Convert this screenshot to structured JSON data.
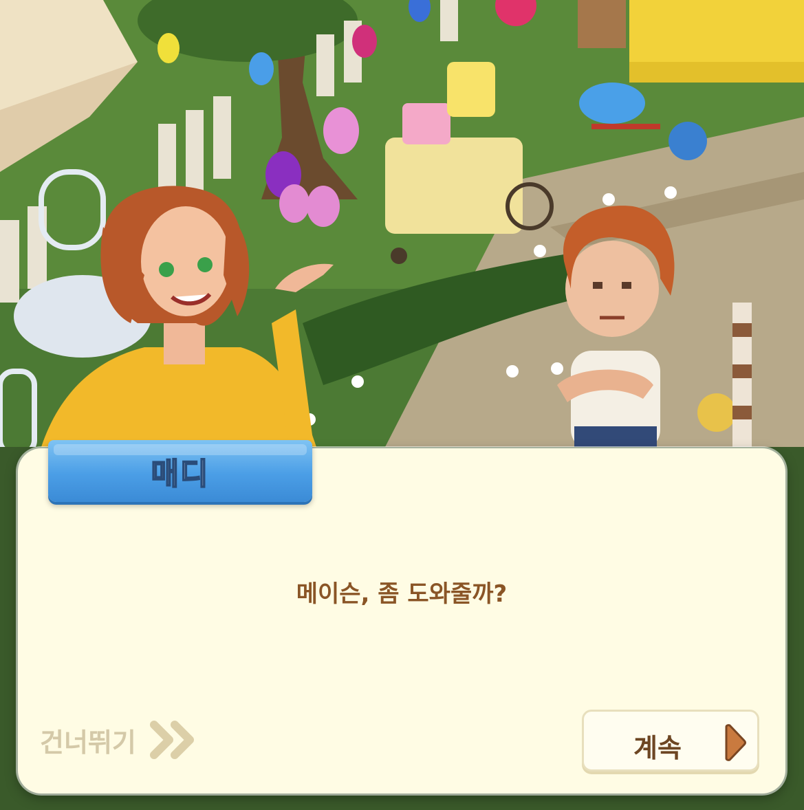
{
  "dialog": {
    "speaker_name": "매디",
    "message": "메이슨, 좀 도와줄까?"
  },
  "controls": {
    "skip_label": "건너뛰기",
    "continue_label": "계속"
  },
  "colors": {
    "panel_bg": "#fffce4",
    "name_tag": "#4b9ee6",
    "message_text": "#8a5526",
    "skip_text": "#d4c9a8",
    "continue_arrow": "#c97a3f"
  },
  "icons": {
    "skip": "double-chevron-right-icon",
    "continue": "play-arrow-icon"
  }
}
